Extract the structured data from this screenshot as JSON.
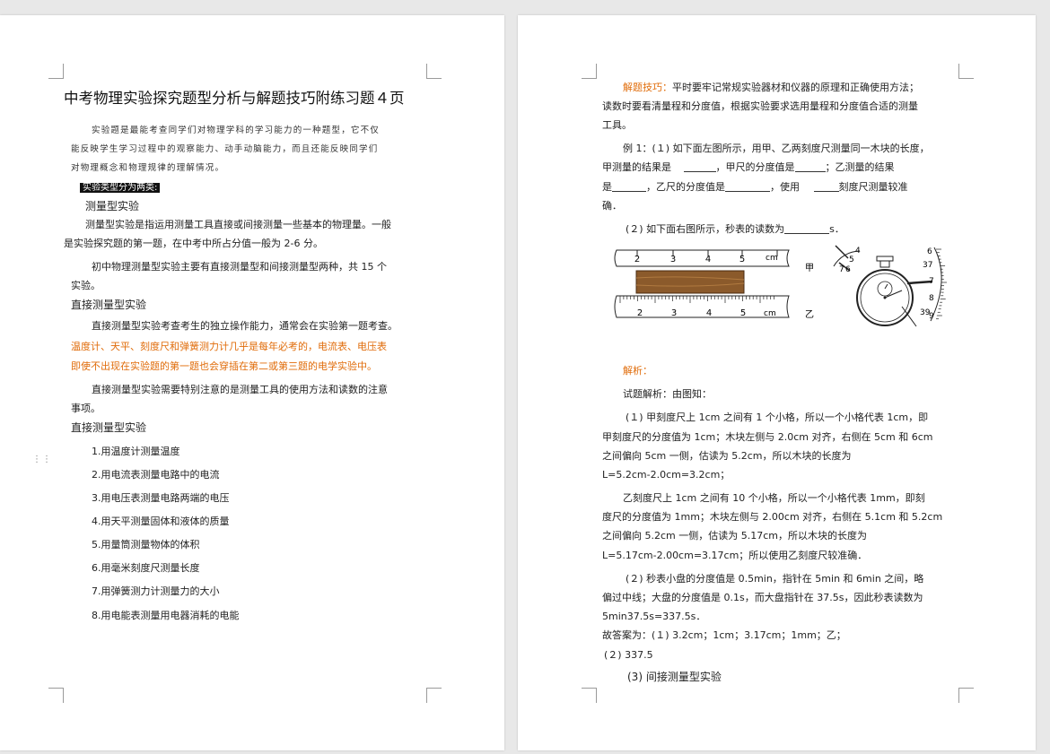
{
  "left_page": {
    "title": "中考物理实验探究题型分析与解题技巧附练习题４页",
    "intro": [
      "实验题是最能考查同学们对物理学科的学习能力的一种题型，它不仅",
      "能反映学生学习过程中的观察能力、动手动脑能力，而且还能反映同学们",
      "对物理概念和物理规律的理解情况。"
    ],
    "highlight": "实验类型分为两类:",
    "section1": "测量型实验",
    "para1": [
      "测量型实验是指运用测量工具直接或间接测量一些基本的物理量。一般",
      "是实验探究题的第一题，在中考中所占分值一般为 2-6 分。"
    ],
    "para2": [
      "初中物理测量型实验主要有直接测量型和间接测量型两种，共 15 个",
      "实验。"
    ],
    "section2": "直接测量型实验",
    "para3": "直接测量型实验考查考生的独立操作能力，通常会在实验第一题考查。",
    "orange_lines": [
      "温度计、天平、刻度尺和弹簧测力计几乎是每年必考的，电流表、电压表",
      "即使不出现在实验题的第一题也会穿插在第二或第三题的电学实验中。"
    ],
    "para4": [
      "直接测量型实验需要特别注意的是测量工具的使用方法和读数的注意",
      "事项。"
    ],
    "section3": "直接测量型实验",
    "list": [
      "1.用温度计测量温度",
      "2.用电流表测量电路中的电流",
      "3.用电压表测量电路两端的电压",
      "4.用天平测量固体和液体的质量",
      "5.用量筒测量物体的体积",
      "6.用毫米刻度尺测量长度",
      "7.用弹簧测力计测量力的大小",
      "8.用电能表测量用电器消耗的电能"
    ]
  },
  "right_page": {
    "tip_label": "解题技巧：",
    "tip_line1": "平时要牢记常规实验器材和仪器的原理和正确使用方法；",
    "tip_lines": [
      "读数时要看清量程和分度值，根据实验要求选用量程和分度值合适的测量",
      "工具。"
    ],
    "ex1_line1": "例 1：(１) 如下面左图所示，用甲、乙两刻度尺测量同一木块的长度，",
    "ex1_line2_a": "甲测量的结果是",
    "ex1_line2_b": "，甲尺的分度值是",
    "ex1_line2_c": "；乙测量的结果",
    "ex1_line3_a": "是",
    "ex1_line3_b": "，乙尺的分度值是",
    "ex1_line3_c": "，使用",
    "ex1_line3_d": "刻度尺测量较准",
    "ex1_line4": "确．",
    "ex1_part2_a": "(２) 如下面右图所示，秒表的读数为",
    "ex1_part2_b": "s．",
    "ruler": {
      "unit": "cm",
      "labels": [
        "2",
        "3",
        "4",
        "5"
      ],
      "label_jia": "甲",
      "label_yi": "乙"
    },
    "stopwatch": {
      "small_dial": [
        "4",
        "5",
        "6",
        "7"
      ],
      "big_dial": [
        "6",
        "37",
        "7",
        "8",
        "39",
        "9"
      ]
    },
    "analysis_label": "解析：",
    "analysis_intro": "试题解析：由图知：",
    "sol1": [
      "(１) 甲刻度尺上 1cm 之间有 1 个小格，所以一个小格代表 1cm，即",
      "甲刻度尺的分度值为 1cm；木块左侧与 2.0cm 对齐，右侧在 5cm 和 6cm",
      "之间偏向 5cm 一侧，估读为 5.2cm，所以木块的长度为",
      "L=5.2cm-2.0cm=3.2cm；"
    ],
    "sol2": [
      "乙刻度尺上 1cm 之间有 10 个小格，所以一个小格代表 1mm，即刻",
      "度尺的分度值为 1mm；木块左侧与 2.00cm 对齐，右侧在 5.1cm 和 5.2cm",
      "之间偏向 5.2cm 一侧，估读为 5.17cm，所以木块的长度为",
      "L=5.17cm-2.00cm=3.17cm；所以使用乙刻度尺较准确．"
    ],
    "sol3": [
      "(２) 秒表小盘的分度值是 0.5min，指针在 5min 和 6min 之间，略",
      "偏过中线；大盘的分度值是 0.1s，而大盘指针在 37.5s，因此秒表读数为",
      "5min37.5s=337.5s．"
    ],
    "answer": "故答案为：(１) 3.2cm；1cm；3.17cm；1mm；乙；",
    "answer2": "(２) 337.5",
    "section_next": "(3) 间接测量型实验"
  },
  "colors": {
    "accent": "#e06c0a",
    "page_bg": "#ffffff",
    "workspace_bg": "#e8e8e8"
  }
}
